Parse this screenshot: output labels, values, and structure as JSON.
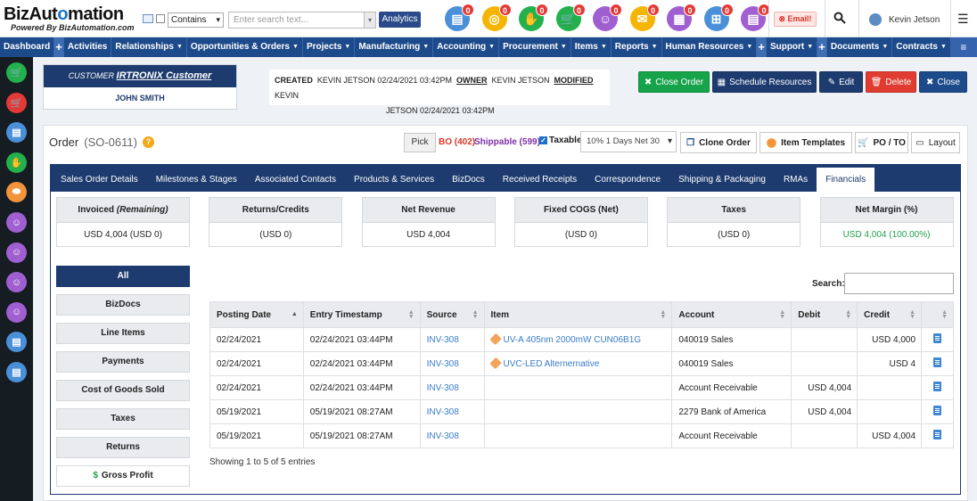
{
  "app": {
    "logo_main": "BizAutomation",
    "logo_sub": "Powered By BizAutomation.com"
  },
  "topbar": {
    "search_scope": "Contains",
    "search_placeholder": "Enter search text...",
    "analytics_label": "Analytics",
    "notification_icons": [
      {
        "name": "orders-icon",
        "color": "#4a90d9",
        "badge": "0"
      },
      {
        "name": "opportunities-icon",
        "color": "#f4b400",
        "badge": "0"
      },
      {
        "name": "handshake-icon",
        "color": "#22b14c",
        "badge": "0"
      },
      {
        "name": "cart-icon",
        "color": "#22b14c",
        "badge": "0"
      },
      {
        "name": "contacts-icon",
        "color": "#a05fd0",
        "badge": "0"
      },
      {
        "name": "mail-icon",
        "color": "#f4b400",
        "badge": "0"
      },
      {
        "name": "calendar-icon",
        "color": "#a05fd0",
        "badge": "0"
      },
      {
        "name": "org-chart-icon",
        "color": "#4a90d9",
        "badge": "0"
      },
      {
        "name": "documents-icon",
        "color": "#a05fd0",
        "badge": "0"
      }
    ],
    "email_label": "Email!",
    "user_name": "Kevin Jetson"
  },
  "nav": [
    {
      "label": "Dashboard",
      "caret": false
    },
    {
      "label": "+",
      "plus": true
    },
    {
      "label": "Activities",
      "caret": false
    },
    {
      "label": "Relationships",
      "caret": true
    },
    {
      "label": "Opportunities & Orders",
      "caret": true
    },
    {
      "label": "Projects",
      "caret": true
    },
    {
      "label": "Manufacturing",
      "caret": true
    },
    {
      "label": "Accounting",
      "caret": true
    },
    {
      "label": "Procurement",
      "caret": true
    },
    {
      "label": "Items",
      "caret": true
    },
    {
      "label": "Reports",
      "caret": true
    },
    {
      "label": "Human Resources",
      "caret": true
    },
    {
      "label": "+",
      "plus": true
    },
    {
      "label": "Support",
      "caret": true
    },
    {
      "label": "+",
      "plus": true
    },
    {
      "label": "Documents",
      "caret": true
    },
    {
      "label": "Contracts",
      "caret": true
    }
  ],
  "sidebar": [
    {
      "name": "cart-icon",
      "color": "#22b14c"
    },
    {
      "name": "cart-icon",
      "color": "#e53935"
    },
    {
      "name": "orders-icon",
      "color": "#4a90d9"
    },
    {
      "name": "handshake-icon",
      "color": "#22b14c"
    },
    {
      "name": "tag-icon",
      "color": "#f4943a"
    },
    {
      "name": "contacts-icon",
      "color": "#a05fd0"
    },
    {
      "name": "contacts-icon",
      "color": "#a05fd0"
    },
    {
      "name": "contacts-icon",
      "color": "#a05fd0"
    },
    {
      "name": "contacts-icon",
      "color": "#a05fd0"
    },
    {
      "name": "orders-icon",
      "color": "#4a90d9"
    },
    {
      "name": "orders-icon",
      "color": "#4a90d9"
    }
  ],
  "customer": {
    "prefix": "CUSTOMER",
    "name": "IRTRONIX Customer",
    "contact": "JOHN SMITH"
  },
  "meta": {
    "created_label": "CREATED",
    "created_value": "KEVIN JETSON 02/24/2021 03:42PM",
    "owner_label": "OWNER",
    "owner_value": "KEVIN JETSON",
    "modified_label": "MODIFIED",
    "modified_value_1": "KEVIN",
    "modified_value_2": "JETSON 02/24/2021 03:42PM"
  },
  "actions": {
    "close_order": "Close Order",
    "schedule": "Schedule Resources",
    "edit": "Edit",
    "delete": "Delete",
    "close": "Close"
  },
  "order": {
    "title": "Order",
    "id": "(SO-0611)",
    "pick": "Pick",
    "bo": "BO (402)",
    "shippable": "Shippable (599)",
    "taxable": "Taxable",
    "terms": "10% 1 Days Net 30",
    "clone": "Clone Order",
    "templates": "Item Templates",
    "po": "PO / TO",
    "layout": "Layout"
  },
  "tabs": [
    "Sales Order Details",
    "Milestones & Stages",
    "Associated Contacts",
    "Products & Services",
    "BizDocs",
    "Received Receipts",
    "Correspondence",
    "Shipping & Packaging",
    "RMAs",
    "Financials"
  ],
  "active_tab": 9,
  "kpis": [
    {
      "label": "Invoiced",
      "sub": "(Remaining)",
      "value": "USD 4,004 (USD 0)",
      "green": false
    },
    {
      "label": "Returns/Credits",
      "value": "(USD 0)",
      "green": false
    },
    {
      "label": "Net Revenue",
      "value": "USD 4,004",
      "green": false
    },
    {
      "label": "Fixed COGS (Net)",
      "value": "(USD 0)",
      "green": false
    },
    {
      "label": "Taxes",
      "value": "(USD 0)",
      "green": false
    },
    {
      "label": "Net Margin (%)",
      "value": "USD 4,004 (100.00%)",
      "green": true
    }
  ],
  "filters": [
    "All",
    "BizDocs",
    "Line Items",
    "Payments",
    "Cost of Goods Sold",
    "Taxes",
    "Returns",
    "Gross Profit"
  ],
  "gross_profit_symbol": "$",
  "search_label": "Search:",
  "table": {
    "columns": [
      "Posting Date",
      "Entry Timestamp",
      "Source",
      "Item",
      "Account",
      "Debit",
      "Credit",
      ""
    ],
    "rows": [
      {
        "posting": "02/24/2021",
        "entry": "02/24/2021 03:44PM",
        "source": "INV-308",
        "item": "UV-A 405nm 2000mW CUN06B1G",
        "account": "040019 Sales",
        "debit": "",
        "credit": "USD 4,000"
      },
      {
        "posting": "02/24/2021",
        "entry": "02/24/2021 03:44PM",
        "source": "INV-308",
        "item": "UVC-LED Alternernative",
        "account": "040019 Sales",
        "debit": "",
        "credit": "USD 4"
      },
      {
        "posting": "02/24/2021",
        "entry": "02/24/2021 03:44PM",
        "source": "INV-308",
        "item": "",
        "account": "Account Receivable",
        "debit": "USD 4,004",
        "credit": ""
      },
      {
        "posting": "05/19/2021",
        "entry": "05/19/2021 08:27AM",
        "source": "INV-308",
        "item": "",
        "account": "2279 Bank of America",
        "debit": "USD 4,004",
        "credit": ""
      },
      {
        "posting": "05/19/2021",
        "entry": "05/19/2021 08:27AM",
        "source": "INV-308",
        "item": "",
        "account": "Account Receivable",
        "debit": "",
        "credit": "USD 4,004"
      }
    ],
    "footer": "Showing 1 to 5 of 5 entries"
  }
}
